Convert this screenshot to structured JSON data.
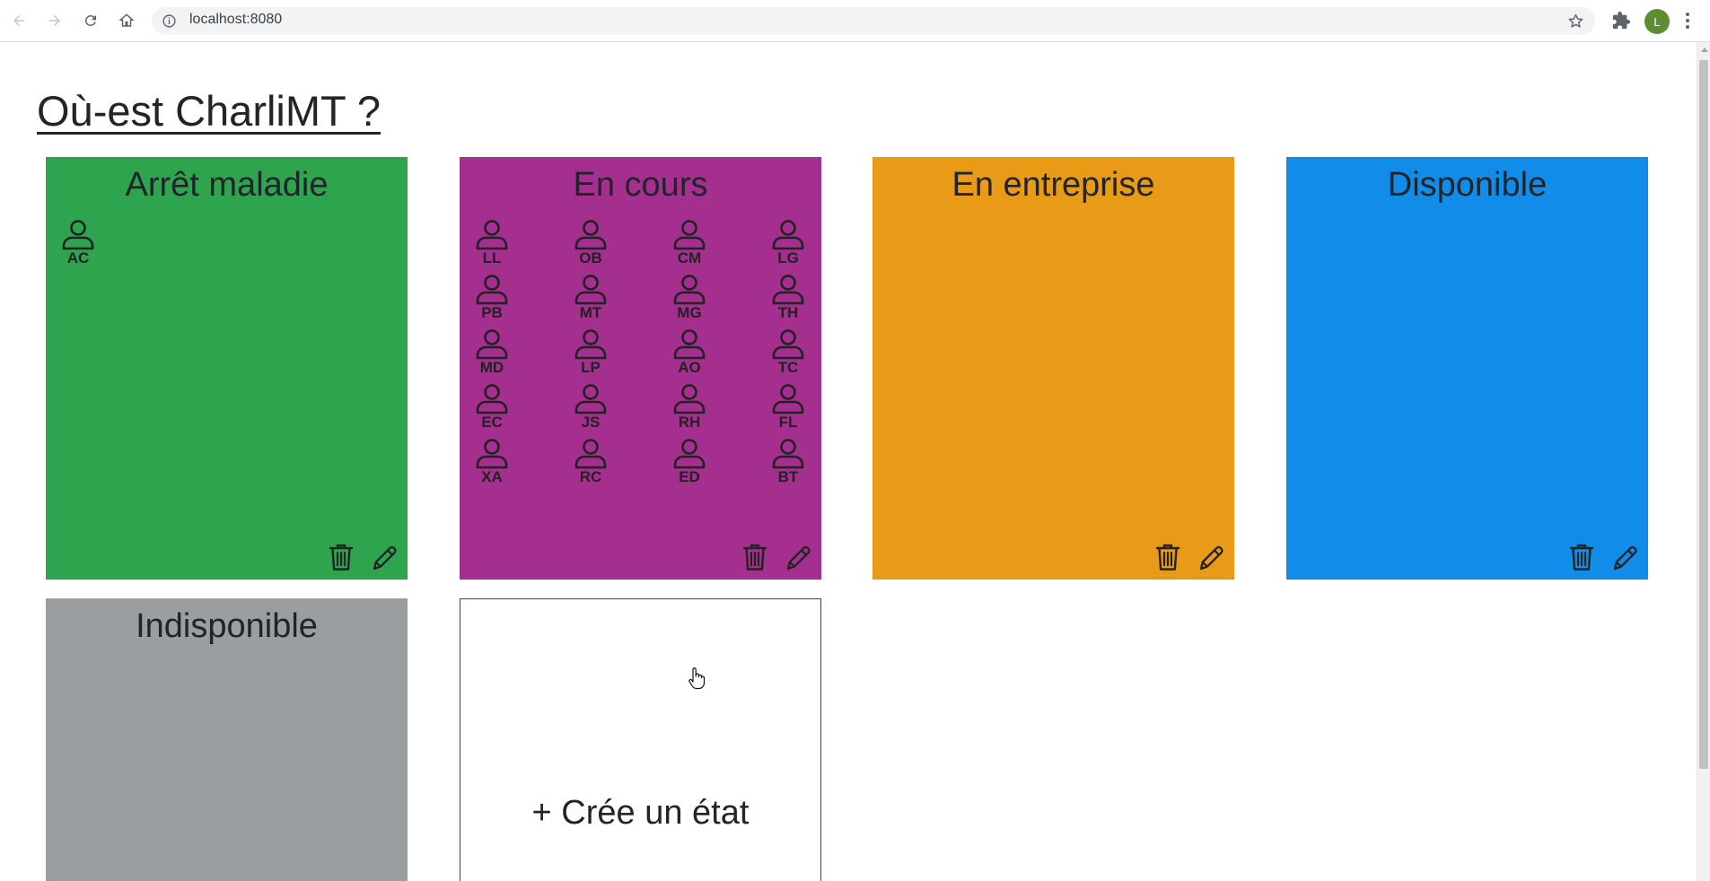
{
  "browser": {
    "url": "localhost:8080",
    "avatar_letter": "L"
  },
  "page": {
    "title": "Où-est CharliMT ?"
  },
  "states": [
    {
      "title": "Arrêt maladie",
      "color": "#2ea44f",
      "people": [
        "AC"
      ]
    },
    {
      "title": "En cours",
      "color": "#a42f8e",
      "people": [
        "LL",
        "OB",
        "CM",
        "LG",
        "PB",
        "MT",
        "MG",
        "TH",
        "MD",
        "LP",
        "AO",
        "TC",
        "EC",
        "JS",
        "RH",
        "FL",
        "XA",
        "RC",
        "ED",
        "BT"
      ]
    },
    {
      "title": "En entreprise",
      "color": "#e99a16",
      "people": []
    },
    {
      "title": "Disponible",
      "color": "#118ce8",
      "people": []
    },
    {
      "title": "Indisponible",
      "color": "#9a9ea0",
      "people": []
    }
  ],
  "add_state": {
    "label": "+ Crée un état"
  },
  "icons": {
    "person": "person-icon",
    "delete": "trash-icon",
    "edit": "pencil-icon"
  }
}
